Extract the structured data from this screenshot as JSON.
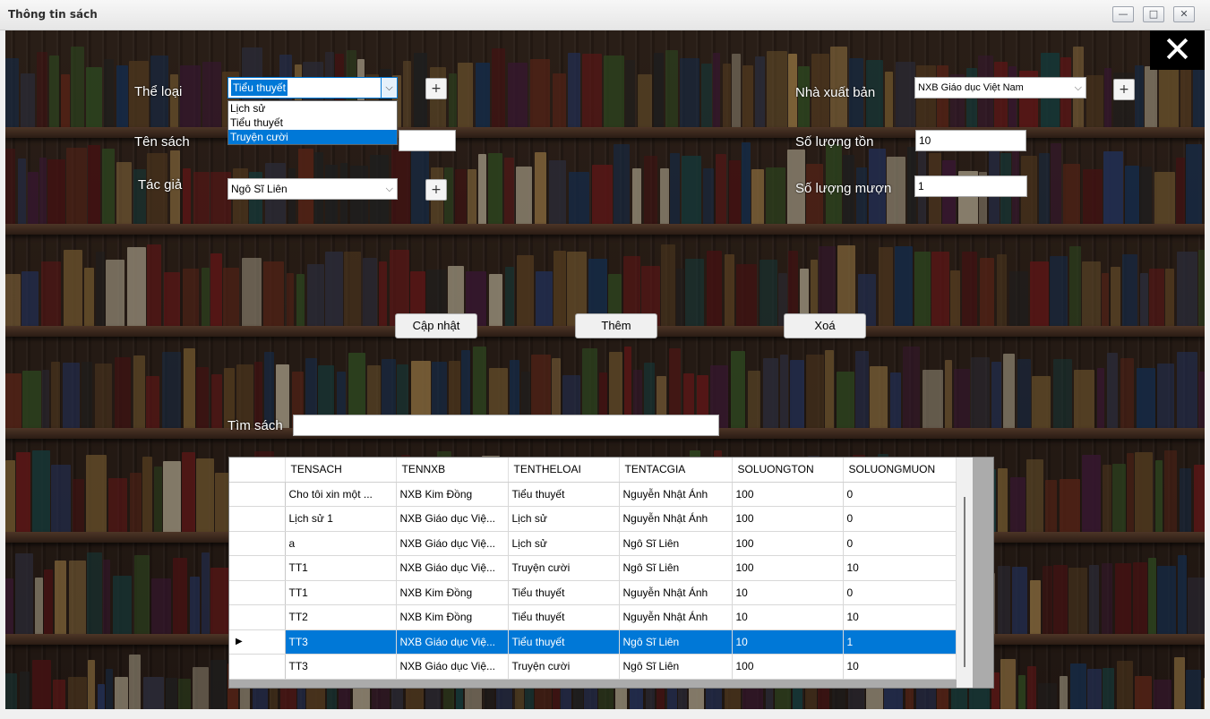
{
  "window": {
    "title": "Thông tin sách",
    "buttons": {
      "minimize": "—",
      "maximize": "□",
      "close": "✕"
    }
  },
  "close_overlay": "✕",
  "form": {
    "the_loai": {
      "label": "Thể loại",
      "value": "Tiểu thuyết",
      "options": [
        "Lịch sử",
        "Tiểu thuyết",
        "Truyện cười"
      ],
      "highlighted_option": "Truyện cười"
    },
    "ten_sach": {
      "label": "Tên sách",
      "value": ""
    },
    "tac_gia": {
      "label": "Tác giả",
      "value": "Ngô Sĩ Liên"
    },
    "nha_xuat_ban": {
      "label": "Nhà xuất bản",
      "value": "NXB Giáo dục Việt Nam"
    },
    "so_luong_ton": {
      "label": "Số lượng tồn",
      "value": "10"
    },
    "so_luong_muon": {
      "label": "Số lượng mượn",
      "value": "1"
    },
    "plus_label": "+",
    "search": {
      "label": "Tìm sách",
      "value": ""
    }
  },
  "actions": {
    "update": "Cập nhật",
    "add": "Thêm",
    "delete": "Xoá"
  },
  "grid": {
    "columns": [
      "TENSACH",
      "TENNXB",
      "TENTHELOAI",
      "TENTACGIA",
      "SOLUONGTON",
      "SOLUONGMUON"
    ],
    "rows": [
      [
        "Cho tôi xin một ...",
        "NXB Kim Đồng",
        "Tiểu thuyết",
        "Nguyễn Nhật Ánh",
        "100",
        "0"
      ],
      [
        "Lịch sử 1",
        "NXB Giáo dục Việ...",
        "Lịch sử",
        "Nguyễn Nhật Ánh",
        "100",
        "0"
      ],
      [
        "a",
        "NXB Giáo dục Việ...",
        "Lịch sử",
        "Ngô Sĩ Liên",
        "100",
        "0"
      ],
      [
        "TT1",
        "NXB Giáo dục Việ...",
        "Truyện cười",
        "Ngô Sĩ Liên",
        "100",
        "10"
      ],
      [
        "TT1",
        "NXB Kim Đồng",
        "Tiểu thuyết",
        "Nguyễn Nhật Ánh",
        "10",
        "0"
      ],
      [
        "TT2",
        "NXB Kim Đồng",
        "Tiểu thuyết",
        "Nguyễn Nhật Ánh",
        "10",
        "10"
      ],
      [
        "TT3",
        "NXB Giáo dục Việ...",
        "Tiểu thuyết",
        "Ngô Sĩ Liên",
        "10",
        "1"
      ],
      [
        "TT3",
        "NXB Giáo dục Việ...",
        "Truyện cười",
        "Ngô Sĩ Liên",
        "100",
        "10"
      ]
    ],
    "selected_row": 6,
    "current_row_marker": "▶"
  },
  "colors": {
    "selection": "#0078d7",
    "background": "#2c1f18"
  }
}
